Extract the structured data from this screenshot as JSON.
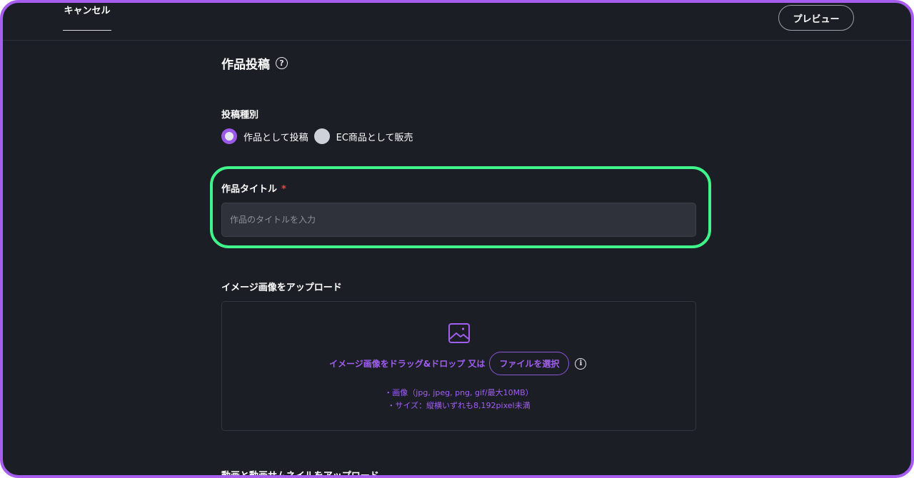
{
  "header": {
    "cancel_label": "キャンセル",
    "preview_label": "プレビュー"
  },
  "page": {
    "title": "作品投稿",
    "help_glyph": "?"
  },
  "post_type": {
    "label": "投稿種別",
    "options": [
      {
        "label": "作品として投稿",
        "selected": true
      },
      {
        "label": "EC商品として販売",
        "selected": false
      }
    ]
  },
  "title_field": {
    "label": "作品タイトル",
    "required_mark": "*",
    "placeholder": "作品のタイトルを入力",
    "value": ""
  },
  "image_upload": {
    "label": "イメージ画像をアップロード",
    "icon": "image-icon",
    "drop_text": "イメージ画像をドラッグ&ドロップ 又は",
    "file_button_label": "ファイルを選択",
    "info_glyph": "i",
    "notes": [
      "・画像（jpg, jpeg, png, gif/最大10MB）",
      "・サイズ：縦横いずれも8,192pixel未満"
    ]
  },
  "video_upload": {
    "label": "動画と動画サムネイルをアップロード"
  },
  "colors": {
    "accent": "#9b59e8",
    "highlight": "#3ff58b",
    "background": "#1c1e26",
    "required": "#ef4343"
  }
}
